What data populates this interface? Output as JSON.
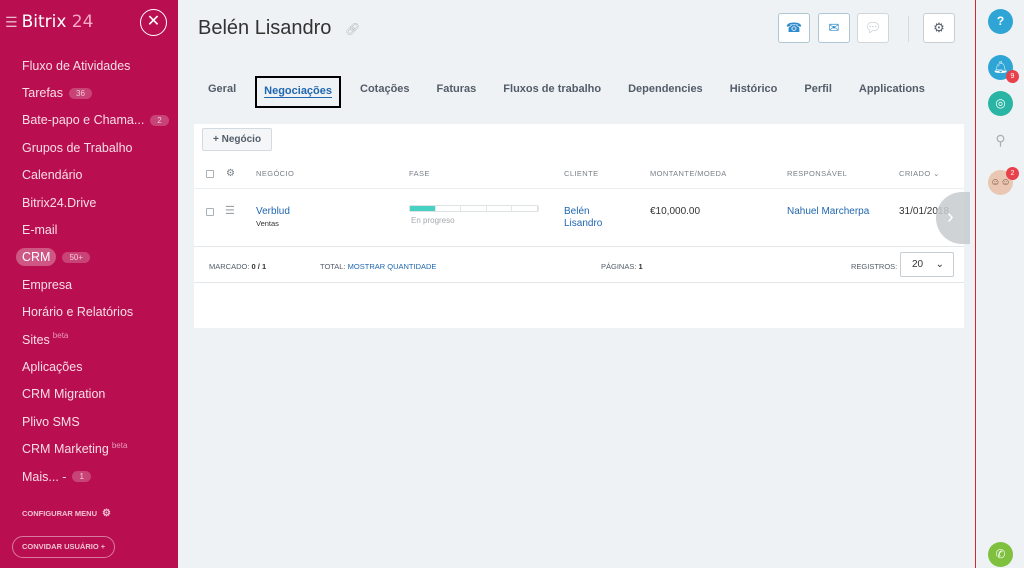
{
  "sidebar": {
    "brand_name": "Bitrix",
    "brand_num": "24",
    "items": [
      {
        "label": "Fluxo de Atividades",
        "count": "",
        "sup": ""
      },
      {
        "label": "Tarefas",
        "count": "36",
        "sup": ""
      },
      {
        "label": "Bate-papo e Chama...",
        "count": "2",
        "sup": ""
      },
      {
        "label": "Grupos de Trabalho",
        "count": "",
        "sup": ""
      },
      {
        "label": "Calendário",
        "count": "",
        "sup": ""
      },
      {
        "label": "Bitrix24.Drive",
        "count": "",
        "sup": ""
      },
      {
        "label": "E-mail",
        "count": "",
        "sup": ""
      },
      {
        "label": "CRM",
        "count": "50+",
        "sup": ""
      },
      {
        "label": "Empresa",
        "count": "",
        "sup": ""
      },
      {
        "label": "Horário e Relatórios",
        "count": "",
        "sup": ""
      },
      {
        "label": "Sites",
        "count": "",
        "sup": "beta"
      },
      {
        "label": "Aplicações",
        "count": "",
        "sup": ""
      },
      {
        "label": "CRM Migration",
        "count": "",
        "sup": ""
      },
      {
        "label": "Plivo SMS",
        "count": "",
        "sup": ""
      },
      {
        "label": "CRM Marketing",
        "count": "",
        "sup": "beta"
      },
      {
        "label": "Mais... -",
        "count": "1",
        "sup": ""
      }
    ],
    "configure": "CONFIGURAR MENU",
    "invite": "CONVIDAR USUÁRIO"
  },
  "header": {
    "title": "Belén Lisandro"
  },
  "tabs": [
    "Geral",
    "Negociações",
    "Cotações",
    "Faturas",
    "Fluxos de trabalho",
    "Dependencies",
    "Histórico",
    "Perfil",
    "Applications"
  ],
  "toolbar": {
    "new_deal": "Negócio"
  },
  "table": {
    "columns": [
      "NEGÓCIO",
      "FASE",
      "CLIENTE",
      "MONTANTE/MOEDA",
      "RESPONSÁVEL",
      "CRIADO"
    ],
    "row": {
      "deal": "Verblud",
      "pipeline": "Ventas",
      "stage": "En progreso",
      "client_line1": "Belén",
      "client_line2": "Lisandro",
      "amount": "€10,000.00",
      "responsible": "Nahuel Marcherpa",
      "created": "31/01/2018"
    },
    "footer": {
      "marked_label": "MARCADO:",
      "marked_value": "0 / 1",
      "total_label": "TOTAL:",
      "total_link": "MOSTRAR QUANTIDADE",
      "pages_label": "PÁGINAS:",
      "pages_value": "1",
      "records_label": "REGISTROS:",
      "records_value": "20"
    }
  },
  "rightbar": {
    "help": "?",
    "notif_count": "9",
    "users_count": "2"
  },
  "colors": {
    "sidebar": "#b90f50",
    "accent": "#2067b0",
    "progress": "#47d1c3"
  }
}
